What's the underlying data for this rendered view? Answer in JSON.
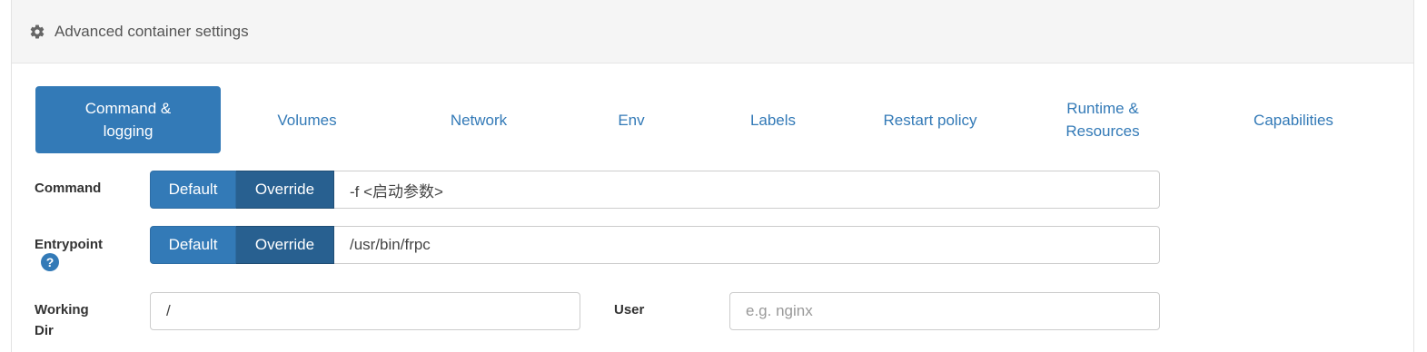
{
  "panel": {
    "title": "Advanced container settings",
    "icon": "gear-icon"
  },
  "tabs": [
    {
      "label_line1": "Command &",
      "label_line2": "logging",
      "active": true
    },
    {
      "label": "Volumes"
    },
    {
      "label": "Network"
    },
    {
      "label": "Env"
    },
    {
      "label": "Labels"
    },
    {
      "label": "Restart policy"
    },
    {
      "label_line1": "Runtime &",
      "label_line2": "Resources"
    },
    {
      "label": "Capabilities"
    }
  ],
  "command": {
    "label": "Command",
    "default_label": "Default",
    "override_label": "Override",
    "value": "-f <启动参数>"
  },
  "entrypoint": {
    "label": "Entrypoint",
    "default_label": "Default",
    "override_label": "Override",
    "value": "/usr/bin/frpc",
    "help_icon": "question-circle-icon"
  },
  "working_dir": {
    "label_line1": "Working",
    "label_line2": "Dir",
    "value": "/"
  },
  "user": {
    "label": "User",
    "placeholder": "e.g. nginx",
    "value": ""
  },
  "colors": {
    "primary": "#337ab7",
    "primary_dark": "#286090"
  }
}
